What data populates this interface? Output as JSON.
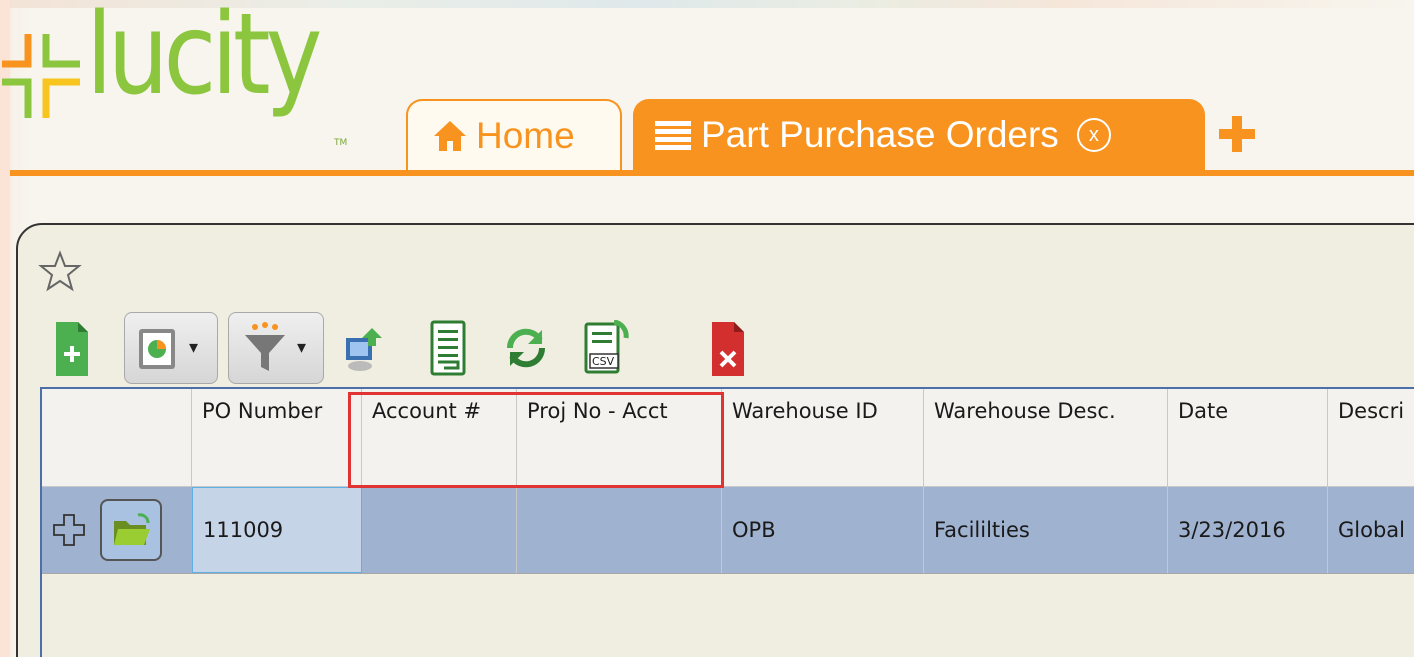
{
  "app": {
    "logo_text": "lucity",
    "logo_tm": "TM",
    "brand_color": "#8cc63f",
    "accent_color": "#f7931e"
  },
  "tabs": [
    {
      "label": "Home",
      "icon": "home-icon",
      "active": false
    },
    {
      "label": "Part Purchase Orders",
      "icon": "list-icon",
      "active": true,
      "close_label": "x"
    }
  ],
  "add_tab_icon": "plus-icon",
  "toolbar": {
    "icons": [
      "favorite-star-icon",
      "new-record-icon",
      "dashboard-icon",
      "filter-icon",
      "export-icon",
      "report-icon",
      "refresh-icon",
      "csv-export-icon",
      "delete-icon"
    ]
  },
  "grid": {
    "columns": [
      "PO Number",
      "Account #",
      "Proj No - Acct",
      "Warehouse ID",
      "Warehouse Desc.",
      "Date",
      "Descri"
    ],
    "highlighted_columns": [
      "Account #",
      "Proj No - Acct"
    ],
    "rows": [
      {
        "po_number": "111009",
        "account": "",
        "proj_no_acct": "",
        "warehouse_id": "OPB",
        "warehouse_desc": "Facililties",
        "date": "3/23/2016",
        "description": "Global"
      }
    ]
  }
}
